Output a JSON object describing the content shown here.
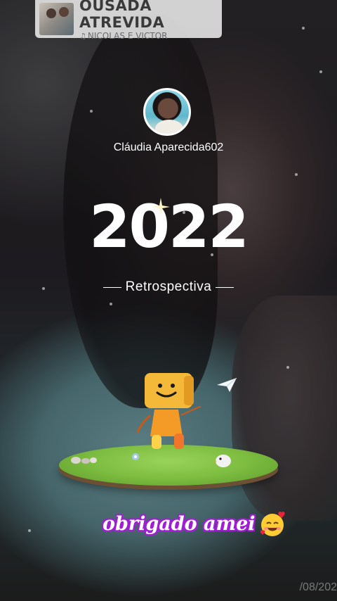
{
  "music": {
    "title": "OUSADA ATREVIDA",
    "artist": "NICOLAS E VICTOR",
    "note_icon": "music-note-icon"
  },
  "profile": {
    "username": "Cláudia Aparecida602"
  },
  "recap": {
    "year": "2022",
    "subtitle": "Retrospectiva"
  },
  "caption": {
    "text": "obrigado amei",
    "emoji": "smiling-face-with-hearts-icon"
  },
  "footer": {
    "date": "/08/202"
  },
  "colors": {
    "caption_outline": "#a21fd6",
    "grass": "#7dbd40",
    "robot": "#f5a623"
  }
}
